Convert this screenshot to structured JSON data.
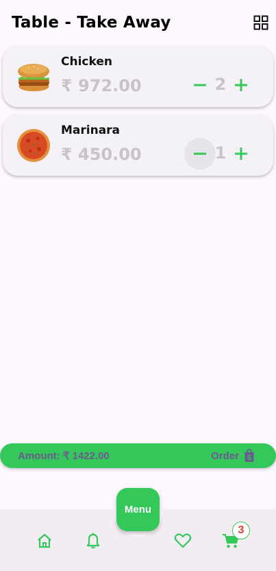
{
  "header": {
    "title": "Table - Take Away",
    "grid_icon": "grid-view-icon"
  },
  "items": [
    {
      "name": "Chicken",
      "price": "₹ 972.00",
      "qty": "2",
      "image": "burger-image"
    },
    {
      "name": "Marinara",
      "price": "₹ 450.00",
      "qty": "1",
      "image": "pizza-image"
    }
  ],
  "summary": {
    "amount": "Amount: ₹ 1422.00",
    "order_label": "Order",
    "order_icon": "shopping-bag-icon"
  },
  "nav": {
    "menu_label": "Menu",
    "cart_count": "3",
    "icons": [
      "home-icon",
      "bell-icon",
      "heart-icon",
      "cart-icon"
    ]
  },
  "colors": {
    "accent": "#34c759",
    "price_gray": "#c7c3c9",
    "amount_text": "#6b5b8f",
    "badge_text": "#e53935",
    "background": "#fdf7fe"
  }
}
